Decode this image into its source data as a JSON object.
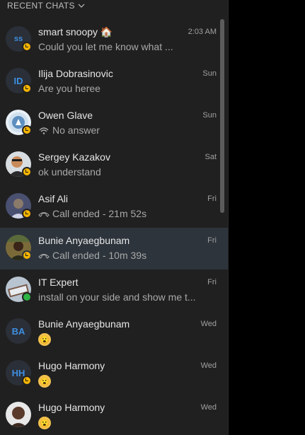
{
  "header": {
    "title": "RECENT CHATS"
  },
  "chats": [
    {
      "name": "smart snoopy 🏠",
      "time": "2:03 AM",
      "preview": "Could you let me know what ...",
      "initials": "ss",
      "status": "away",
      "avatar_color": "#2b2f38",
      "preview_icon": ""
    },
    {
      "name": "Ilija Dobrasinovic",
      "time": "Sun",
      "preview": "Are you heree",
      "initials": "ID",
      "status": "away",
      "avatar_color": "#2b2f38",
      "preview_icon": ""
    },
    {
      "name": "Owen Glave",
      "time": "Sun",
      "preview": "No answer",
      "initials": "",
      "status": "away",
      "avatar_color": "#d9e6f2",
      "preview_icon": "missed-call-icon"
    },
    {
      "name": "Sergey Kazakov",
      "time": "Sat",
      "preview": "ok understand",
      "initials": "",
      "status": "away",
      "avatar_color": "#c98a5a",
      "preview_icon": ""
    },
    {
      "name": "Asif Ali",
      "time": "Fri",
      "preview": "Call ended - 21m 52s",
      "initials": "",
      "status": "away",
      "avatar_color": "#6a6f8a",
      "preview_icon": "call-ended-icon"
    },
    {
      "name": "Bunie Anyaegbunam",
      "time": "Fri",
      "preview": "Call ended - 10m 39s",
      "initials": "",
      "status": "away",
      "avatar_color": "#7a6a3a",
      "preview_icon": "call-ended-icon"
    },
    {
      "name": "IT Expert",
      "time": "Fri",
      "preview": "install on your side and show me t...",
      "initials": "",
      "status": "online",
      "avatar_color": "#9aa8b8",
      "preview_icon": ""
    },
    {
      "name": "Bunie  Anyaegbunam",
      "time": "Wed",
      "preview": "",
      "initials": "BA",
      "status": "none",
      "avatar_color": "#2b2f38",
      "preview_icon": "emoji-icon"
    },
    {
      "name": "Hugo Harmony",
      "time": "Wed",
      "preview": "",
      "initials": "HH",
      "status": "away",
      "avatar_color": "#2b2f38",
      "preview_icon": "emoji-icon"
    },
    {
      "name": "Hugo Harmony",
      "time": "Wed",
      "preview": "",
      "initials": "",
      "status": "none",
      "avatar_color": "#5a3a2a",
      "preview_icon": "emoji-icon"
    }
  ],
  "selected_index": 5
}
